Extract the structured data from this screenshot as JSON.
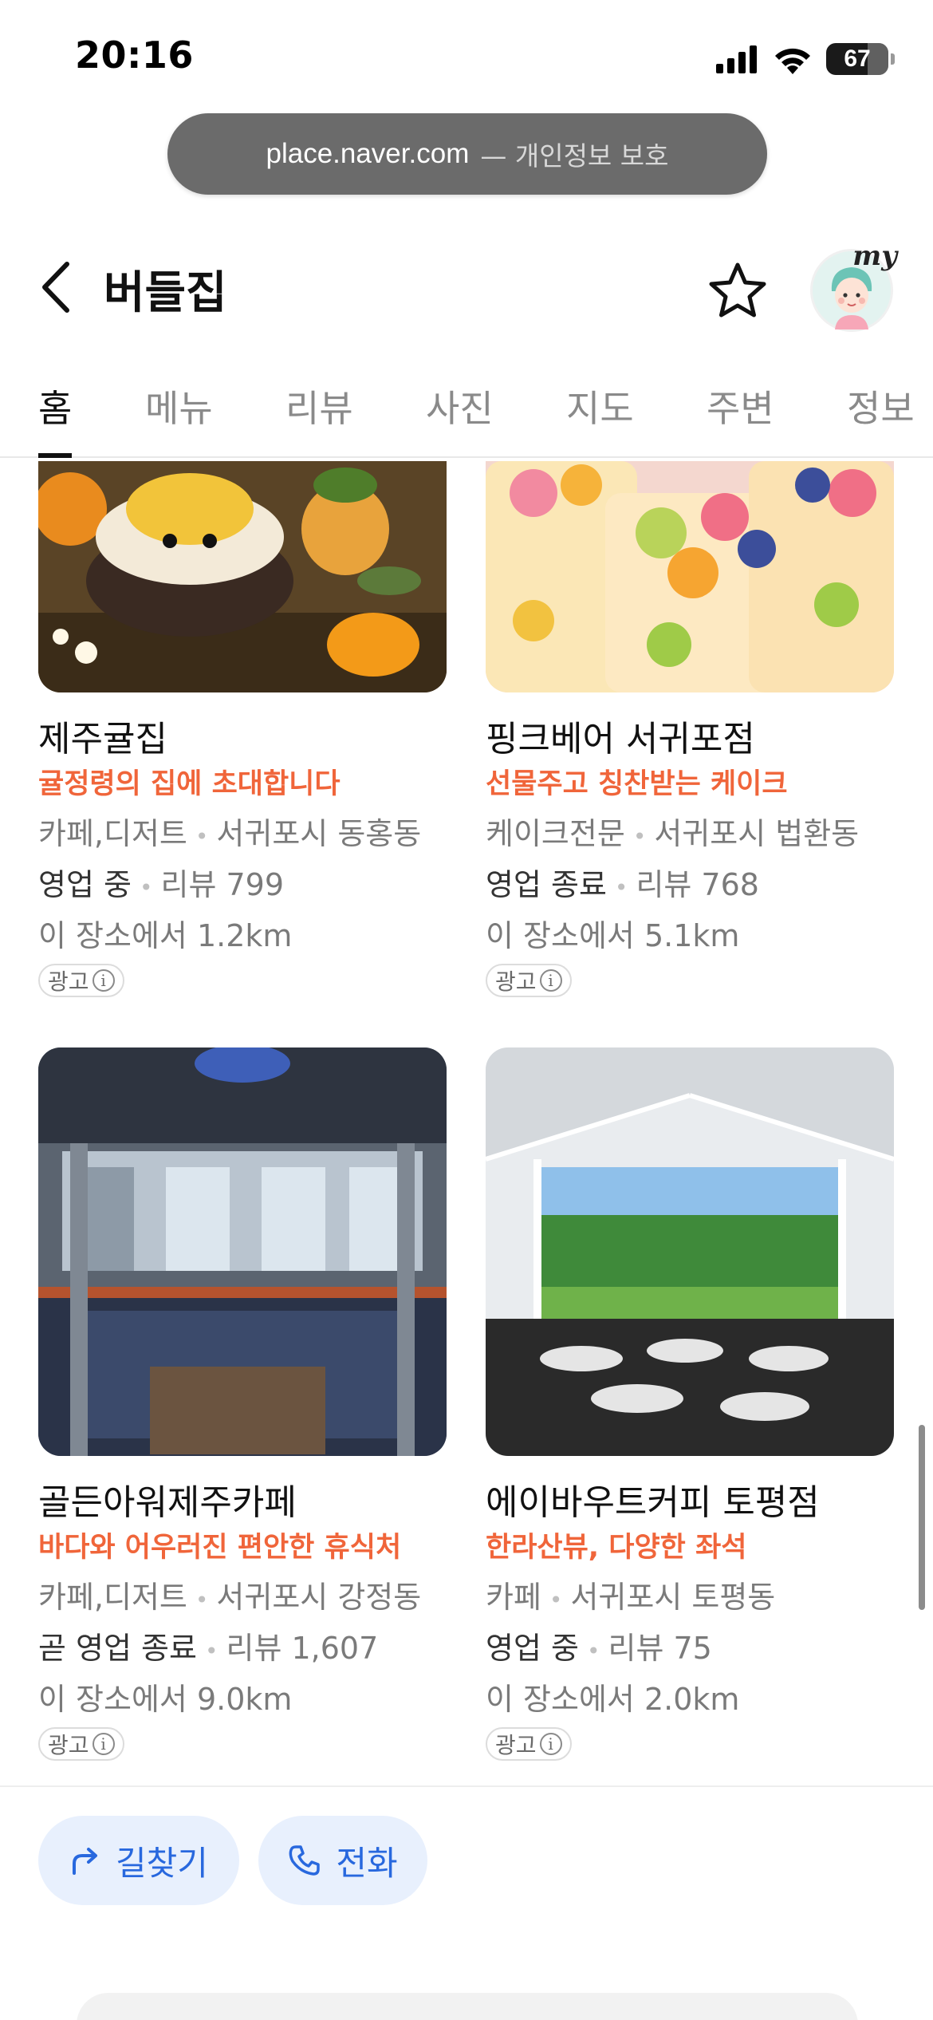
{
  "status": {
    "time": "20:16",
    "battery": "67"
  },
  "url_bar": {
    "host": "place.naver.com",
    "note": "— 개인정보 보호"
  },
  "header": {
    "title": "버들집",
    "my_label": "my"
  },
  "tabs": [
    {
      "label": "홈",
      "active": true
    },
    {
      "label": "메뉴"
    },
    {
      "label": "리뷰"
    },
    {
      "label": "사진"
    },
    {
      "label": "지도"
    },
    {
      "label": "주변"
    },
    {
      "label": "정보"
    }
  ],
  "cards": [
    {
      "name": "제주귤집",
      "promo": "귤정령의 집에 초대합니다",
      "category": "카페,디저트",
      "location": "서귀포시 동홍동",
      "status": "영업 중",
      "reviews": "리뷰 799",
      "distance": "이 장소에서 1.2km",
      "ad": "광고"
    },
    {
      "name": "핑크베어 서귀포점",
      "promo": "선물주고 칭찬받는 케이크",
      "category": "케이크전문",
      "location": "서귀포시 법환동",
      "status": "영업 종료",
      "reviews": "리뷰 768",
      "distance": "이 장소에서 5.1km",
      "ad": "광고"
    },
    {
      "name": "골든아워제주카페",
      "promo": "바다와 어우러진 편안한 휴식처",
      "category": "카페,디저트",
      "location": "서귀포시 강정동",
      "status": "곧 영업 종료",
      "reviews": "리뷰 1,607",
      "distance": "이 장소에서 9.0km",
      "ad": "광고"
    },
    {
      "name": "에이바우트커피 토평점",
      "promo": "한라산뷰, 다양한 좌석",
      "category": "카페",
      "location": "서귀포시 토평동",
      "status": "영업 중",
      "reviews": "리뷰 75",
      "distance": "이 장소에서 2.0km",
      "ad": "광고"
    }
  ],
  "actions": {
    "directions": "길찾기",
    "call": "전화"
  },
  "colors": {
    "promo": "#f0653a",
    "action_text": "#2868de",
    "action_bg": "#e8f0fd"
  }
}
